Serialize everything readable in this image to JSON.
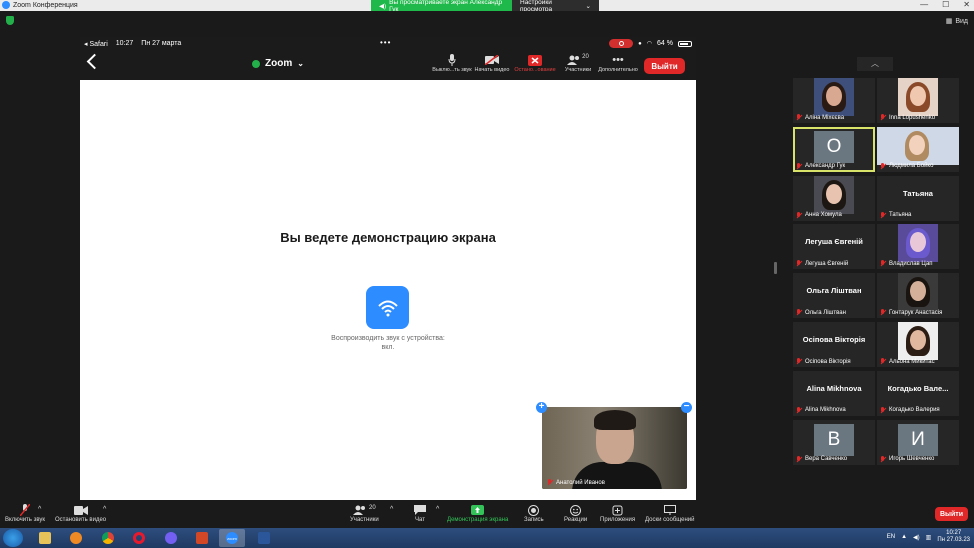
{
  "window": {
    "title": "Zoom Конференция",
    "share_banner": "Вы просматриваете экран Александр Гук",
    "view_settings": "Настройки просмотра",
    "view_button": "Вид"
  },
  "ios_status": {
    "back_app": "◂ Safari",
    "time": "10:27",
    "date": "Пн 27 марта",
    "battery": "64 %"
  },
  "zoom_toolbar": {
    "title": "Zoom",
    "buttons": [
      {
        "label": "Выклю...ть звук",
        "icon": "mic-icon"
      },
      {
        "label": "Начать видео",
        "icon": "video-off-icon"
      },
      {
        "label": "Остано...ование",
        "icon": "stop-share-icon"
      },
      {
        "label": "Участники",
        "icon": "participants-icon",
        "count": "20"
      },
      {
        "label": "Дополнительно",
        "icon": "more-icon"
      }
    ],
    "leave": "Выйти"
  },
  "share_screen": {
    "title": "Вы ведете демонстрацию экрана",
    "audio_label": "Воспроизводить звук с устройства: вкл."
  },
  "self_video": {
    "name": "Анатолий Иванов"
  },
  "participants": [
    {
      "name": "Аліна Міхєєва",
      "kind": "photo"
    },
    {
      "name": "Inna Lopushenko",
      "kind": "photo"
    },
    {
      "name": "Александр Гук",
      "kind": "initial",
      "initial": "О",
      "active": true
    },
    {
      "name": "Людмила Бойко",
      "kind": "photo"
    },
    {
      "name": "Анна Хомула",
      "kind": "photo"
    },
    {
      "name": "Татьяна",
      "kind": "name",
      "display": "Татьяна"
    },
    {
      "name": "Легуша Євгеній",
      "kind": "name",
      "display": "Легуша Євгеній"
    },
    {
      "name": "Владислав Цап",
      "kind": "photo"
    },
    {
      "name": "Ольга Ліштван",
      "kind": "name",
      "display": "Ольга Ліштван"
    },
    {
      "name": "Гонтарук Анастасія",
      "kind": "photo"
    },
    {
      "name": "Осіпова Вікторія",
      "kind": "name",
      "display": "Осіпова Вікторія"
    },
    {
      "name": "Альона Микитас",
      "kind": "photo"
    },
    {
      "name": "Alina Mikhnova",
      "kind": "name",
      "display": "Alina Mikhnova"
    },
    {
      "name": "Когадько Валерия",
      "kind": "name",
      "display": "Когадько  Вале..."
    },
    {
      "name": "Вера Савченко",
      "kind": "initial",
      "initial": "В"
    },
    {
      "name": "Игорь Шевченко",
      "kind": "initial",
      "initial": "И"
    }
  ],
  "bottom_bar": {
    "unmute": "Включить звук",
    "stop_video": "Остановить видео",
    "participants": "Участники",
    "participants_count": "20",
    "chat": "Чат",
    "share": "Демонстрация экрана",
    "record": "Запись",
    "reactions": "Реакции",
    "apps": "Приложения",
    "whiteboards": "Доски сообщений",
    "leave": "Выйти"
  },
  "taskbar": {
    "lang": "EN",
    "time": "10:27",
    "date": "Пн 27.03.23",
    "zoom_label": "zoom"
  }
}
